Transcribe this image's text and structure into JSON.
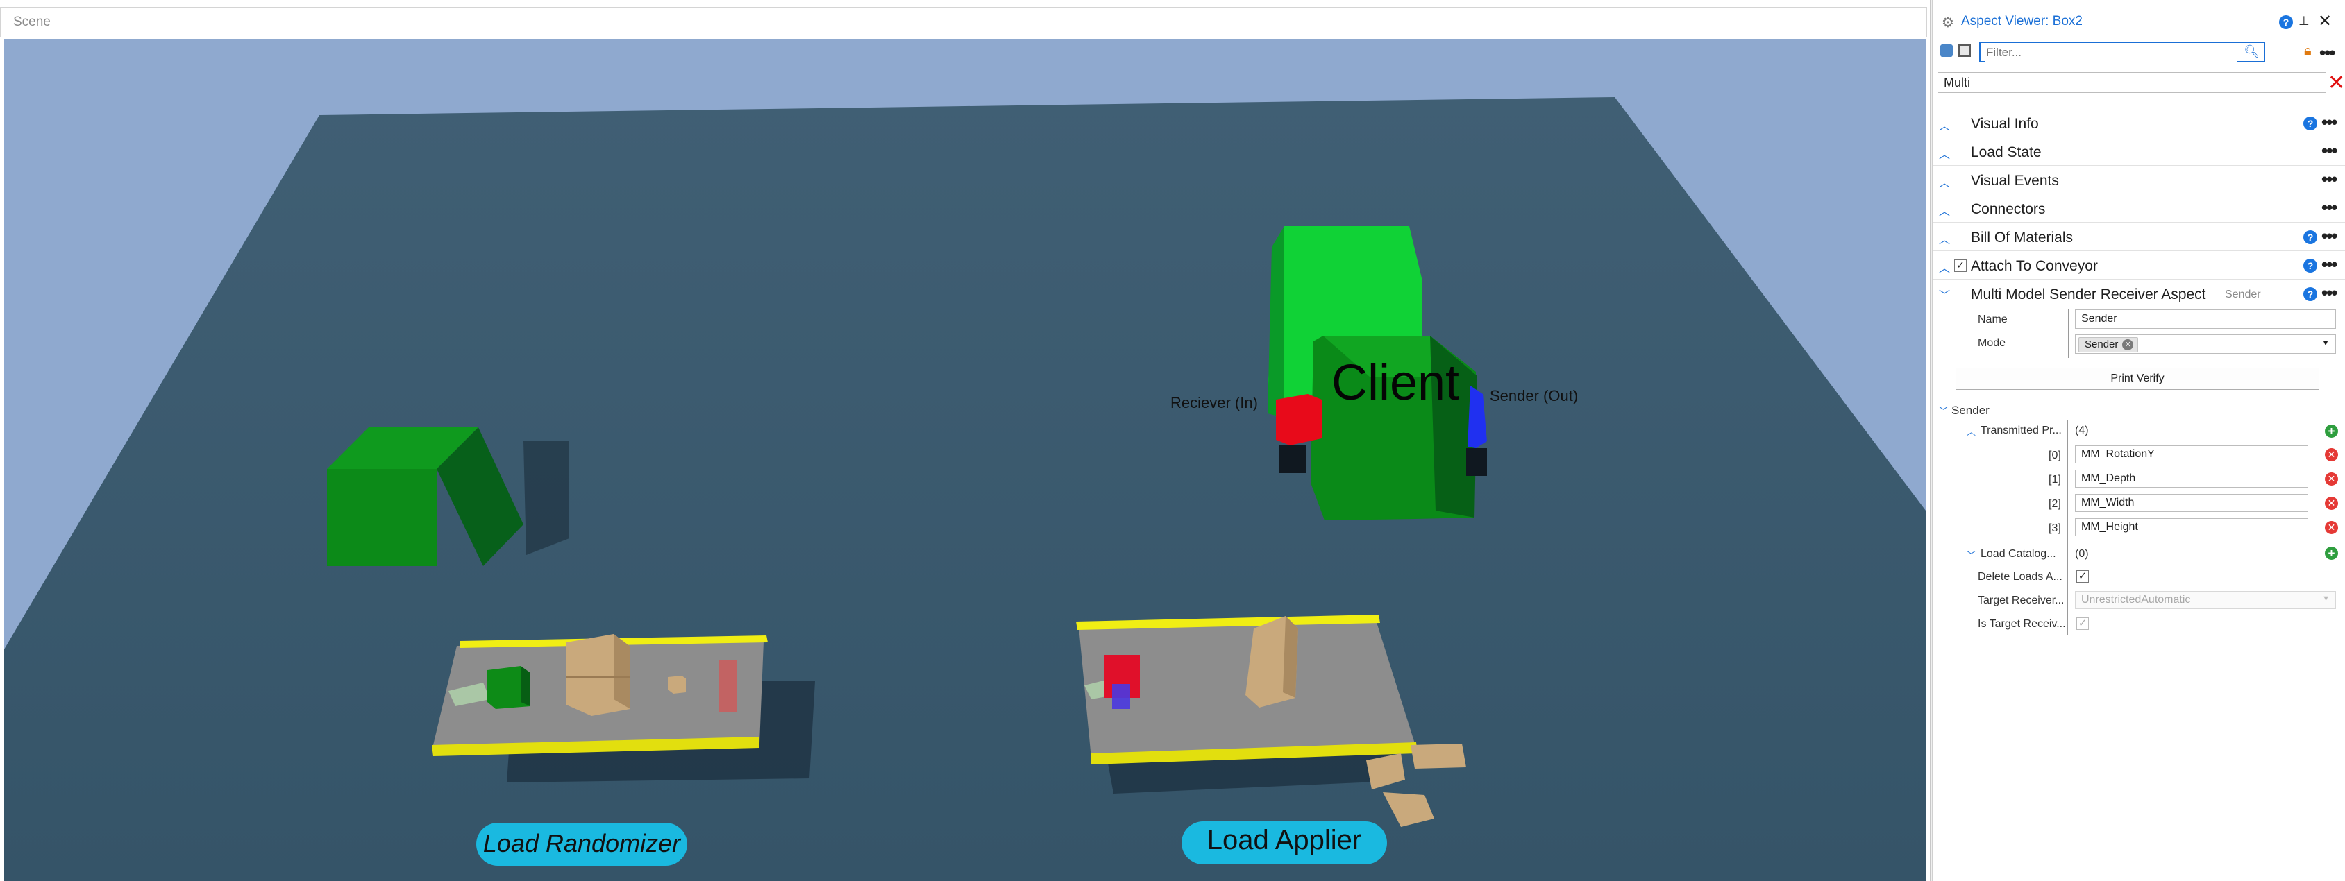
{
  "scene": {
    "title": "Scene",
    "labels": {
      "client": "Client",
      "receiver_in": "Reciever (In)",
      "sender_out": "Sender (Out)",
      "load_randomizer": "Load Randomizer",
      "load_applier": "Load Applier"
    },
    "colors": {
      "sky": "#8fa9cf",
      "floor": "#3a5a6e",
      "conveyor_rail": "#f0ee14",
      "belt": "#8d8d8d",
      "green_box": "#0a8a14",
      "label_bubble": "#1ab9e0"
    }
  },
  "aspect_viewer": {
    "title": "Aspect Viewer: Box2",
    "filter_placeholder": "Filter...",
    "multi_value": "Multi",
    "sections": [
      {
        "label": "Visual Info",
        "has_help": true
      },
      {
        "label": "Load State",
        "has_help": false
      },
      {
        "label": "Visual Events",
        "has_help": false
      },
      {
        "label": "Connectors",
        "has_help": false
      },
      {
        "label": "Bill Of Materials",
        "has_help": true
      },
      {
        "label": "Attach To Conveyor",
        "has_help": true,
        "checked": true
      },
      {
        "label": "Multi Model Sender Receiver Aspect",
        "subtitle": "Sender",
        "has_help": true,
        "expanded": true
      }
    ],
    "properties": {
      "name_label": "Name",
      "name_value": "Sender",
      "mode_label": "Mode",
      "mode_value": "Sender",
      "print_verify": "Print Verify"
    },
    "sender": {
      "group_label": "Sender",
      "transmitted_label": "Transmitted Pr...",
      "transmitted_count": "(4)",
      "items": [
        {
          "index": "[0]",
          "value": "MM_RotationY"
        },
        {
          "index": "[1]",
          "value": "MM_Depth"
        },
        {
          "index": "[2]",
          "value": "MM_Width"
        },
        {
          "index": "[3]",
          "value": "MM_Height"
        }
      ],
      "load_catalog_label": "Load Catalog...",
      "load_catalog_count": "(0)",
      "delete_loads_label": "Delete Loads A...",
      "delete_loads_checked": true,
      "target_receiver_label": "Target Receiver...",
      "target_receiver_value": "UnrestrictedAutomatic",
      "is_target_label": "Is Target Receiv...",
      "is_target_checked": true
    }
  }
}
